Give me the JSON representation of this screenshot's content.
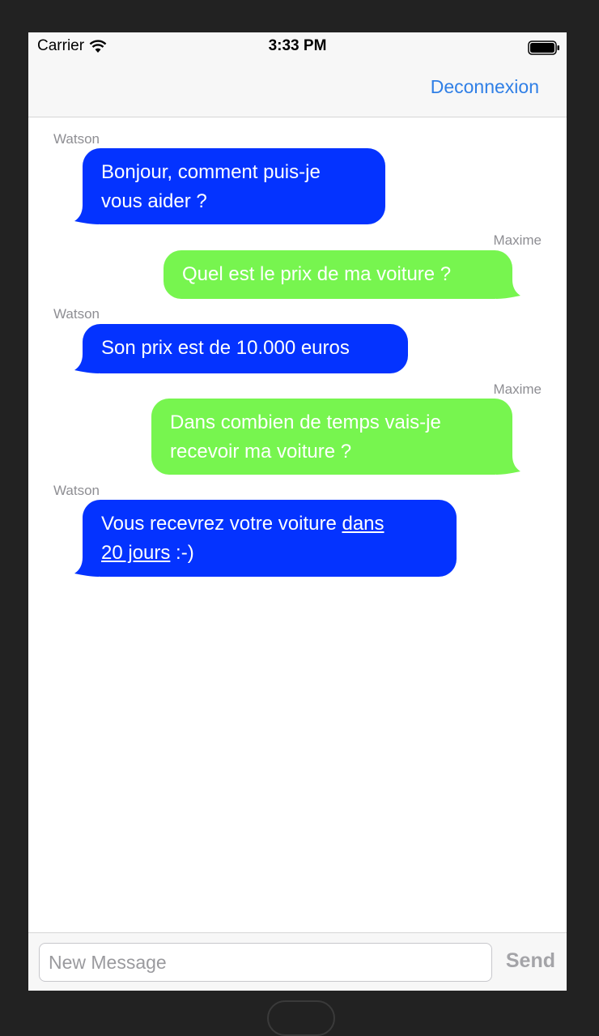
{
  "status_bar": {
    "carrier": "Carrier",
    "time": "3:33 PM",
    "wifi_icon": "wifi-icon",
    "battery_icon": "battery-icon"
  },
  "nav": {
    "action": "Deconnexion"
  },
  "messages": [
    {
      "sender": "Watson",
      "direction": "incoming",
      "line1": "Bonjour, comment puis-je",
      "line2": "vous aider ?"
    },
    {
      "sender": "Maxime",
      "direction": "outgoing",
      "line1": "Quel est le prix de ma voiture ?"
    },
    {
      "sender": "Watson",
      "direction": "incoming",
      "line1": "Son prix est de 10.000 euros"
    },
    {
      "sender": "Maxime",
      "direction": "outgoing",
      "line1": "Dans combien de temps vais-je",
      "line2": "recevoir ma voiture ?"
    },
    {
      "sender": "Watson",
      "direction": "incoming",
      "line1_text": "Vous recevrez votre voiture ",
      "line1_link": "dans",
      "line2_link": "20 jours",
      "line2_text": " :-)"
    }
  ],
  "composer": {
    "placeholder": "New Message",
    "send_label": "Send"
  },
  "colors": {
    "incoming_bubble": "#0433ff",
    "outgoing_bubble": "#77f54f",
    "accent": "#2f7fe6"
  }
}
